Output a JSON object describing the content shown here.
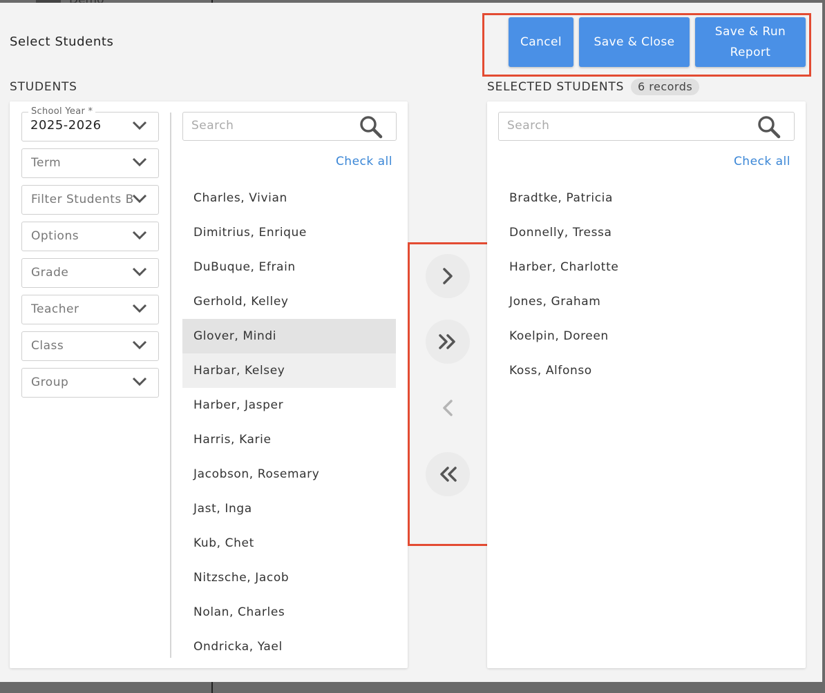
{
  "background": {
    "peek_text": "Demo"
  },
  "dialog": {
    "title": "Select Students",
    "actions": {
      "cancel_label": "Cancel",
      "save_close_label": "Save & Close",
      "save_run_label": "Save & Run Report"
    }
  },
  "students_panel": {
    "heading": "STUDENTS",
    "filters": {
      "school_year": {
        "label": "School Year *",
        "value": "2025-2026"
      },
      "term": "Term",
      "filter_students_by": "Filter Students By",
      "options": "Options",
      "grade": "Grade",
      "teacher": "Teacher",
      "class": "Class",
      "group": "Group"
    },
    "search_placeholder": "Search",
    "check_all_label": "Check all",
    "students": [
      "Charles, Vivian",
      "Dimitrius, Enrique",
      "DuBuque, Efrain",
      "Gerhold, Kelley",
      "Glover, Mindi",
      "Harbar, Kelsey",
      "Harber, Jasper",
      "Harris, Karie",
      "Jacobson, Rosemary",
      "Jast, Inga",
      "Kub, Chet",
      "Nitzsche, Jacob",
      "Nolan, Charles",
      "Ondricka, Yael"
    ]
  },
  "transfer_controls": {
    "add_selected_icon": "chevron-right-icon",
    "add_all_icon": "double-chevron-right-icon",
    "remove_selected_icon": "chevron-left-icon",
    "remove_all_icon": "double-chevron-left-icon"
  },
  "selected_panel": {
    "heading": "SELECTED STUDENTS",
    "record_count": "6 records",
    "search_placeholder": "Search",
    "check_all_label": "Check all",
    "students": [
      "Bradtke, Patricia",
      "Donnelly, Tressa",
      "Harber, Charlotte",
      "Jones, Graham",
      "Koelpin, Doreen",
      "Koss, Alfonso"
    ]
  },
  "colors": {
    "primary_button": "#4a90e6",
    "link": "#3a86d6",
    "highlight_annotation": "#e34b32"
  }
}
